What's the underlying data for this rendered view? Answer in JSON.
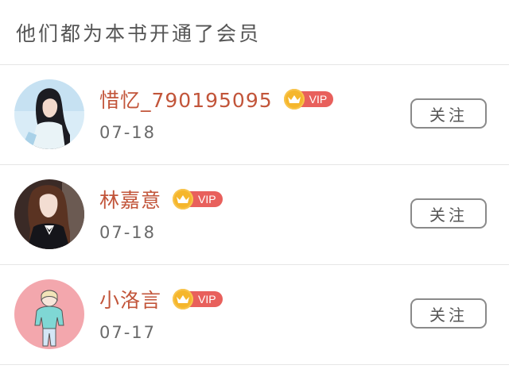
{
  "header": {
    "title": "他们都为本书开通了会员"
  },
  "members": [
    {
      "name": "惜忆_790195095",
      "badge": "VIP",
      "date": "07-18",
      "follow_label": "关注"
    },
    {
      "name": "林嘉意",
      "badge": "VIP",
      "date": "07-18",
      "follow_label": "关注"
    },
    {
      "name": "小洛言",
      "badge": "VIP",
      "date": "07-17",
      "follow_label": "关注"
    }
  ],
  "icons": {
    "crown": "crown-icon"
  },
  "colors": {
    "name": "#c2553a",
    "vip_pill": "#e8605c",
    "crown": "#f5b62c",
    "divider": "#e6e6e6"
  }
}
